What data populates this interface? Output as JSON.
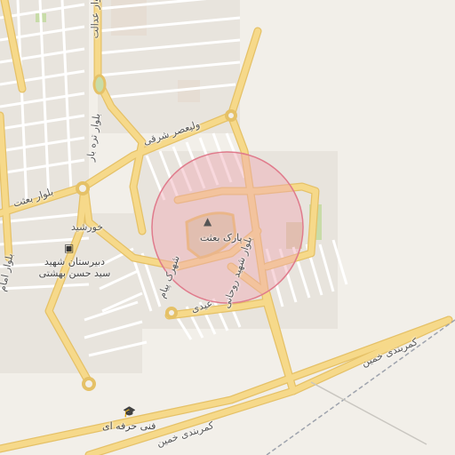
{
  "map": {
    "circle_fill": "#f0a9b4",
    "circle_stroke": "#e07b8c",
    "road_major": "#f6d98a",
    "road_casing": "#e5c167",
    "road_minor": "#ffffff",
    "park_color": "#c8dca8",
    "land_color": "#f2efe9"
  },
  "labels": {
    "valiasr": "ولیعصر شرقی",
    "baasat_blvd": "بلوار بعثت",
    "tarebar_blvd": "بلوار تره بار",
    "khorshid": "خورشید",
    "school": "دبیرستان شهید\nسید حسن بهشتی",
    "park": "پارک بعثت",
    "shahid_rouhani": "بلوار شهید روحانی",
    "shahrak": "شهرک پیام",
    "eidi": "عیدی",
    "kamarbandi1": "کمربندی خمین",
    "kamarbandi2": "کمربندی خمین",
    "fanni": "فنی حرفه ای",
    "blvd_left": "بلوار امام",
    "blvd_topleft": "بلوار عدالت"
  },
  "icons": {
    "park": "tree-icon",
    "school": "school-icon",
    "tech": "graduation-cap-icon"
  }
}
